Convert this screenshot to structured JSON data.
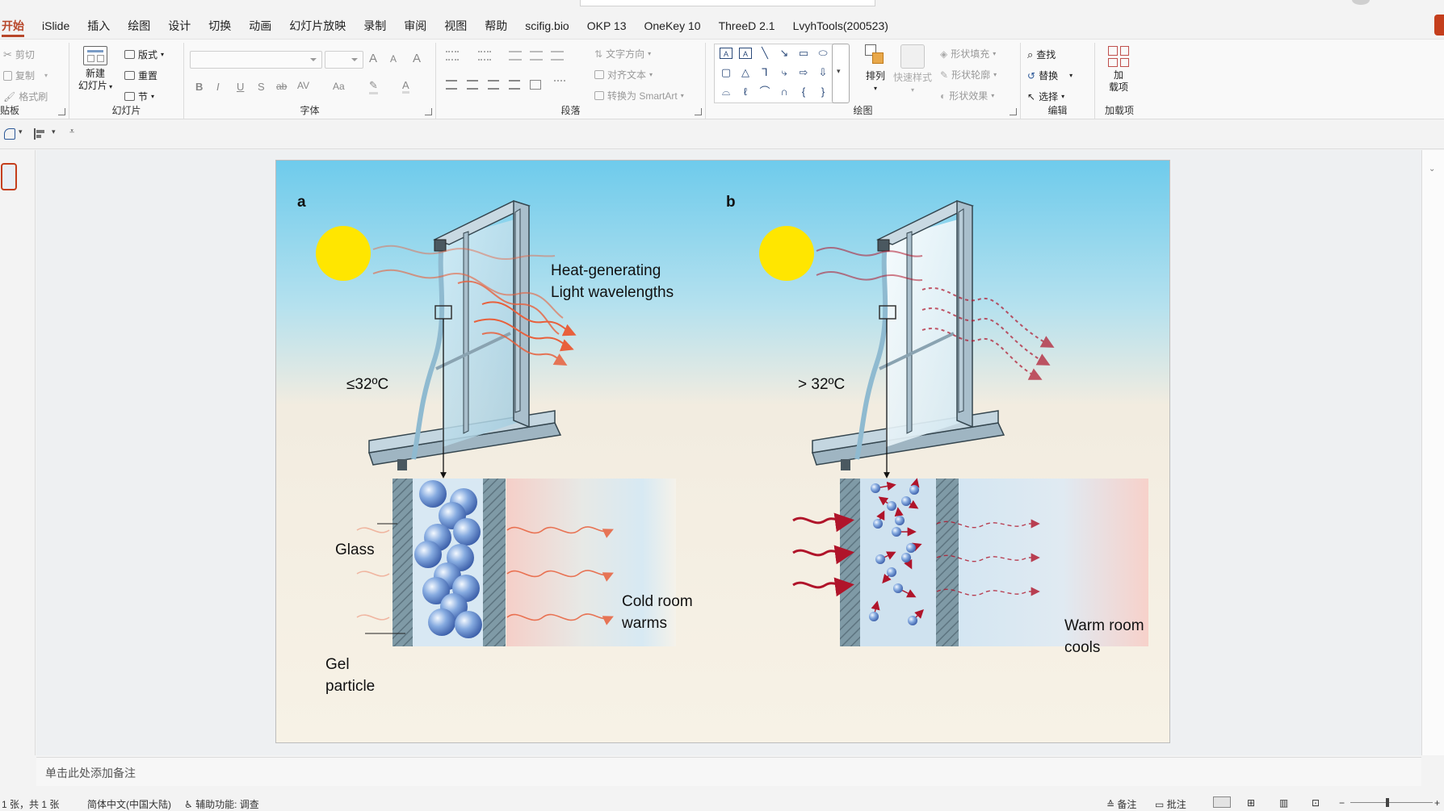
{
  "menu": {
    "tabs": [
      "开始",
      "iSlide",
      "插入",
      "绘图",
      "设计",
      "切换",
      "动画",
      "幻灯片放映",
      "录制",
      "审阅",
      "视图",
      "帮助",
      "scifig.bio",
      "OKP 13",
      "OneKey 10",
      "ThreeD 2.1",
      "LvyhTools(200523)"
    ],
    "active": "开始"
  },
  "ribbon": {
    "clipboard": {
      "cut": "剪切",
      "copy": "复制",
      "format_painter": "格式刷",
      "label": "贴板"
    },
    "slides": {
      "new_slide_line1": "新建",
      "new_slide_line2": "幻灯片",
      "layout": "版式",
      "reset": "重置",
      "section": "节",
      "label": "幻灯片"
    },
    "font": {
      "label": "字体",
      "bold": "B",
      "italic": "I",
      "underline": "U",
      "shadow": "S",
      "strike": "ab",
      "spacing": "AV",
      "case": "Aa",
      "grow": "A",
      "shrink": "A",
      "clear": "A",
      "highlight": "✎",
      "color": "A"
    },
    "paragraph": {
      "label": "段落",
      "text_direction": "文字方向",
      "align_text": "对齐文本",
      "smartart": "转换为 SmartArt"
    },
    "drawing": {
      "label": "绘图",
      "arrange": "排列",
      "quick_styles": "快速样式",
      "fill": "形状填充",
      "outline": "形状轮廓",
      "effects": "形状效果"
    },
    "editing": {
      "label": "编辑",
      "find": "查找",
      "replace": "替换",
      "select": "选择"
    },
    "addins": {
      "label": "加载项",
      "btn_line1": "加",
      "btn_line2": "载项"
    }
  },
  "slide": {
    "panel_a": {
      "letter": "a",
      "heading_line1": "Heat-generating",
      "heading_line2": "Light wavelengths",
      "temperature": "≤32ºC",
      "glass_label": "Glass",
      "gel_label_line1": "Gel",
      "gel_label_line2": "particle",
      "room_label_line1": "Cold room",
      "room_label_line2": "warms"
    },
    "panel_b": {
      "letter": "b",
      "temperature": "> 32ºC",
      "room_label_line1": "Warm room",
      "room_label_line2": "cools"
    }
  },
  "notes_placeholder": "单击此处添加备注",
  "status": {
    "slide_count": "1 张，共 1 张",
    "language": "简体中文(中国大陆)",
    "accessibility": "辅助功能: 调查",
    "notes": "备注",
    "comments": "批注"
  },
  "colors": {
    "accent": "#b7472a",
    "sun": "#ffe600",
    "warm_wave": "#e8603c",
    "hot_wave": "#b0142a",
    "frame": "#a9bfcc"
  }
}
